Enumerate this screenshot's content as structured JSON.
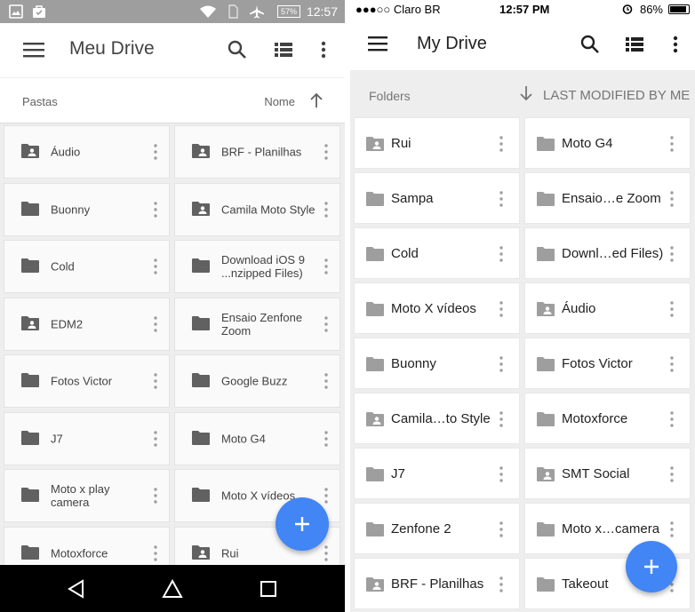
{
  "android": {
    "status": {
      "time": "12:57",
      "battery": "57%"
    },
    "appbar": {
      "title": "Meu Drive",
      "menu_icon": "hamburger-menu-icon",
      "search_icon": "search-icon",
      "view_icon": "list-view-icon",
      "more_icon": "more-vert-icon"
    },
    "sort": {
      "section_label": "Pastas",
      "sort_by": "Nome",
      "direction_icon": "arrow-up-icon"
    },
    "folders": [
      {
        "name": "Áudio",
        "shared": true
      },
      {
        "name": "BRF - Planilhas",
        "shared": true
      },
      {
        "name": "Buonny",
        "shared": false
      },
      {
        "name": "Camila Moto Style",
        "shared": true
      },
      {
        "name": "Cold",
        "shared": false
      },
      {
        "name": "Download iOS 9 ...nzipped Files)",
        "shared": false
      },
      {
        "name": "EDM2",
        "shared": true
      },
      {
        "name": "Ensaio Zenfone Zoom",
        "shared": false
      },
      {
        "name": "Fotos Victor",
        "shared": false
      },
      {
        "name": "Google Buzz",
        "shared": false
      },
      {
        "name": "J7",
        "shared": false
      },
      {
        "name": "Moto G4",
        "shared": false
      },
      {
        "name": "Moto x play camera",
        "shared": false
      },
      {
        "name": "Moto X vídeos",
        "shared": false
      },
      {
        "name": "Motoxforce",
        "shared": false
      },
      {
        "name": "Rui",
        "shared": true
      }
    ],
    "fab_icon": "plus-icon",
    "navbar": {
      "back_icon": "back-triangle-icon",
      "home_icon": "home-circle-icon",
      "recents_icon": "recents-square-icon"
    }
  },
  "ios": {
    "status": {
      "carrier": "●●●○○ Claro BR",
      "time": "12:57 PM",
      "battery": "86%"
    },
    "appbar": {
      "title": "My Drive",
      "menu_icon": "hamburger-menu-icon",
      "search_icon": "search-icon",
      "view_icon": "list-view-icon",
      "more_icon": "more-vert-icon"
    },
    "sort": {
      "section_label": "Folders",
      "sort_by": "LAST MODIFIED BY ME",
      "direction_icon": "arrow-down-icon"
    },
    "folders": [
      {
        "name": "Rui",
        "shared": true
      },
      {
        "name": "Moto G4",
        "shared": false
      },
      {
        "name": "Sampa",
        "shared": false
      },
      {
        "name": "Ensaio…e Zoom",
        "shared": false
      },
      {
        "name": "Cold",
        "shared": false
      },
      {
        "name": "Downl…ed Files)",
        "shared": false
      },
      {
        "name": "Moto X vídeos",
        "shared": false
      },
      {
        "name": "Áudio",
        "shared": true
      },
      {
        "name": "Buonny",
        "shared": false
      },
      {
        "name": "Fotos Victor",
        "shared": false
      },
      {
        "name": "Camila…to Style",
        "shared": true
      },
      {
        "name": "Motoxforce",
        "shared": false
      },
      {
        "name": "J7",
        "shared": false
      },
      {
        "name": "SMT Social",
        "shared": true
      },
      {
        "name": "Zenfone 2",
        "shared": false
      },
      {
        "name": "Moto x…camera",
        "shared": false
      },
      {
        "name": "BRF - Planilhas",
        "shared": true
      },
      {
        "name": "Takeout",
        "shared": false
      }
    ],
    "fab_icon": "plus-icon"
  },
  "colors": {
    "accent": "#4285f4",
    "folder_icon_android": "#616161",
    "folder_icon_ios": "#9e9e9e",
    "background": "#eeeeee"
  }
}
